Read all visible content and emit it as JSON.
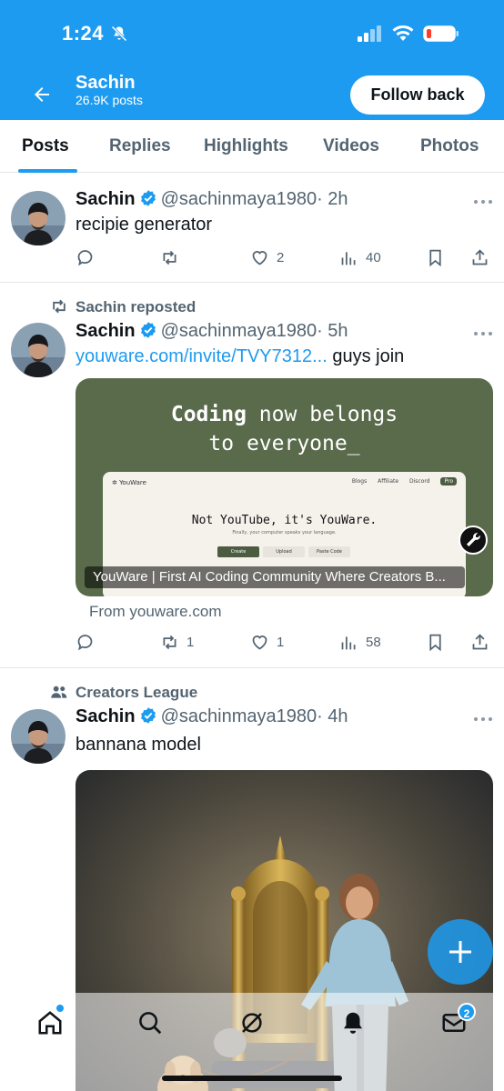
{
  "status_bar": {
    "time": "1:24"
  },
  "header": {
    "name": "Sachin",
    "posts_count": "26.9K posts",
    "follow_label": "Follow back"
  },
  "tabs": [
    "Posts",
    "Replies",
    "Highlights",
    "Videos",
    "Photos"
  ],
  "posts": [
    {
      "author": "Sachin",
      "handle": "@sachinmaya1980",
      "time": "· 2h",
      "text": "recipie generator",
      "replies": "",
      "reposts": "",
      "likes": "2",
      "views": "40"
    },
    {
      "context": "Sachin reposted",
      "author": "Sachin",
      "handle": "@sachinmaya1980",
      "time": "· 5h",
      "link": "youware.com/invite/TVY7312...",
      "text_after": " guys join",
      "card": {
        "headline_bold": "Coding",
        "headline_rest": " now belongs",
        "headline_line2": "to everyone_",
        "mock_logo": "✲ YouWare",
        "mock_nav": "Blogs Affiliate Discord",
        "mock_pro": "Pro",
        "mock_title": "Not YouTube, it's YouWare.",
        "mock_sub": "Finally, your computer speaks your language.",
        "mock_buttons": [
          "Create",
          "Upload",
          "Paste Code"
        ],
        "caption": "YouWare | First AI Coding Community Where Creators B..."
      },
      "from": "From youware.com",
      "replies": "",
      "reposts": "1",
      "likes": "1",
      "views": "58"
    },
    {
      "context": "Creators League",
      "author": "Sachin",
      "handle": "@sachinmaya1980",
      "time": "· 4h",
      "text": "bannana model"
    }
  ],
  "bottom_nav": {
    "messages_badge": "2",
    "icons": [
      "home-icon",
      "search-icon",
      "grok-icon",
      "notifications-icon",
      "messages-icon"
    ]
  },
  "colors": {
    "accent": "#1d9bf0",
    "text": "#0f1419",
    "muted": "#536471",
    "card_bg": "#5a6b4b"
  }
}
